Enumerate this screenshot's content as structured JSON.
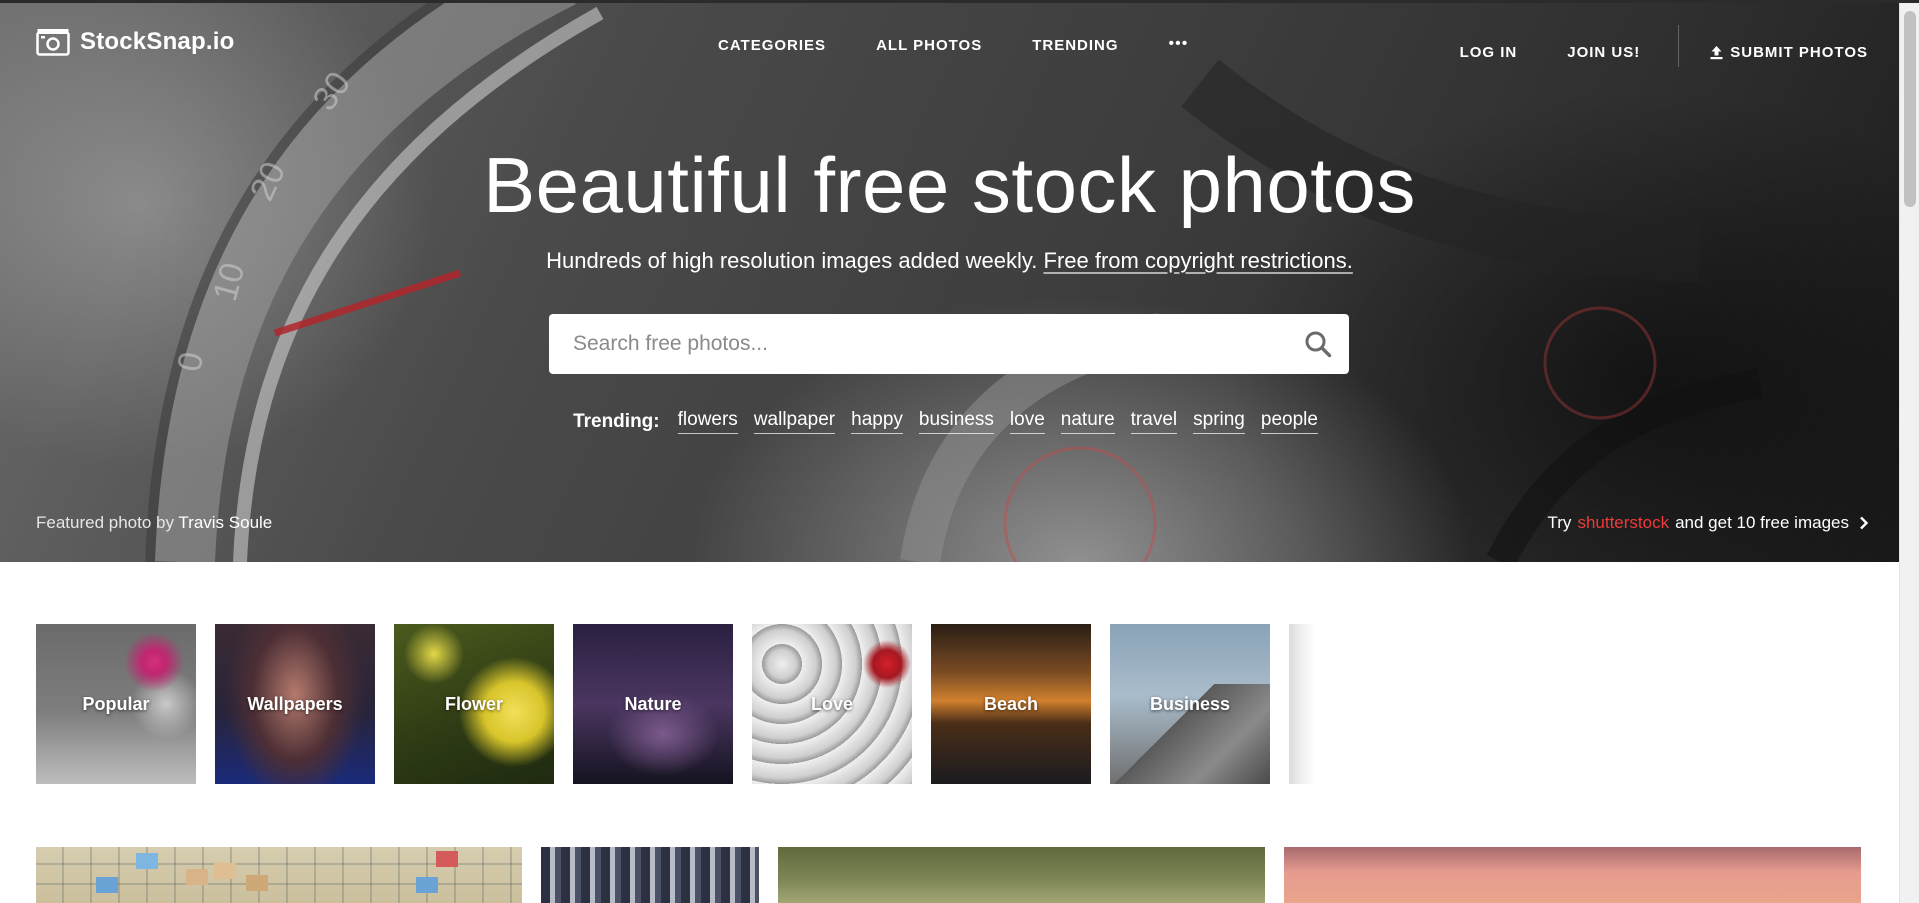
{
  "brand": {
    "name": "StockSnap.io"
  },
  "nav": {
    "links": [
      {
        "label": "CATEGORIES"
      },
      {
        "label": "ALL PHOTOS"
      },
      {
        "label": "TRENDING"
      }
    ],
    "more_label": "•••",
    "login_label": "LOG IN",
    "join_label": "JOIN US!",
    "submit_label": "SUBMIT PHOTOS"
  },
  "hero": {
    "headline": "Beautiful free stock photos",
    "subline_text": "Hundreds of high resolution images added weekly.",
    "subline_link": "Free from copyright restrictions.",
    "search_placeholder": "Search free photos...",
    "search_value": "",
    "trending_label": "Trending:",
    "trending_tags": [
      "flowers",
      "wallpaper",
      "happy",
      "business",
      "love",
      "nature",
      "travel",
      "spring",
      "people"
    ],
    "credit_prefix": "Featured photo by",
    "credit_author": "Travis Soule",
    "promo_prefix": "Try",
    "promo_brand": "shutterstock",
    "promo_suffix": "and get 10 free images"
  },
  "categories": [
    {
      "label": "Popular"
    },
    {
      "label": "Wallpapers"
    },
    {
      "label": "Flower"
    },
    {
      "label": "Nature"
    },
    {
      "label": "Love"
    },
    {
      "label": "Beach"
    },
    {
      "label": "Business"
    },
    {
      "label": ""
    }
  ],
  "icons": {
    "logo": "camera-icon",
    "search": "search-icon",
    "upload": "upload-icon",
    "promo_arrow": "chevron-right-icon",
    "more": "more-dots-icon"
  },
  "colors": {
    "promo_brand": "#ee3a3a",
    "nav_text": "#ffffff",
    "page_bg": "#ffffff"
  }
}
